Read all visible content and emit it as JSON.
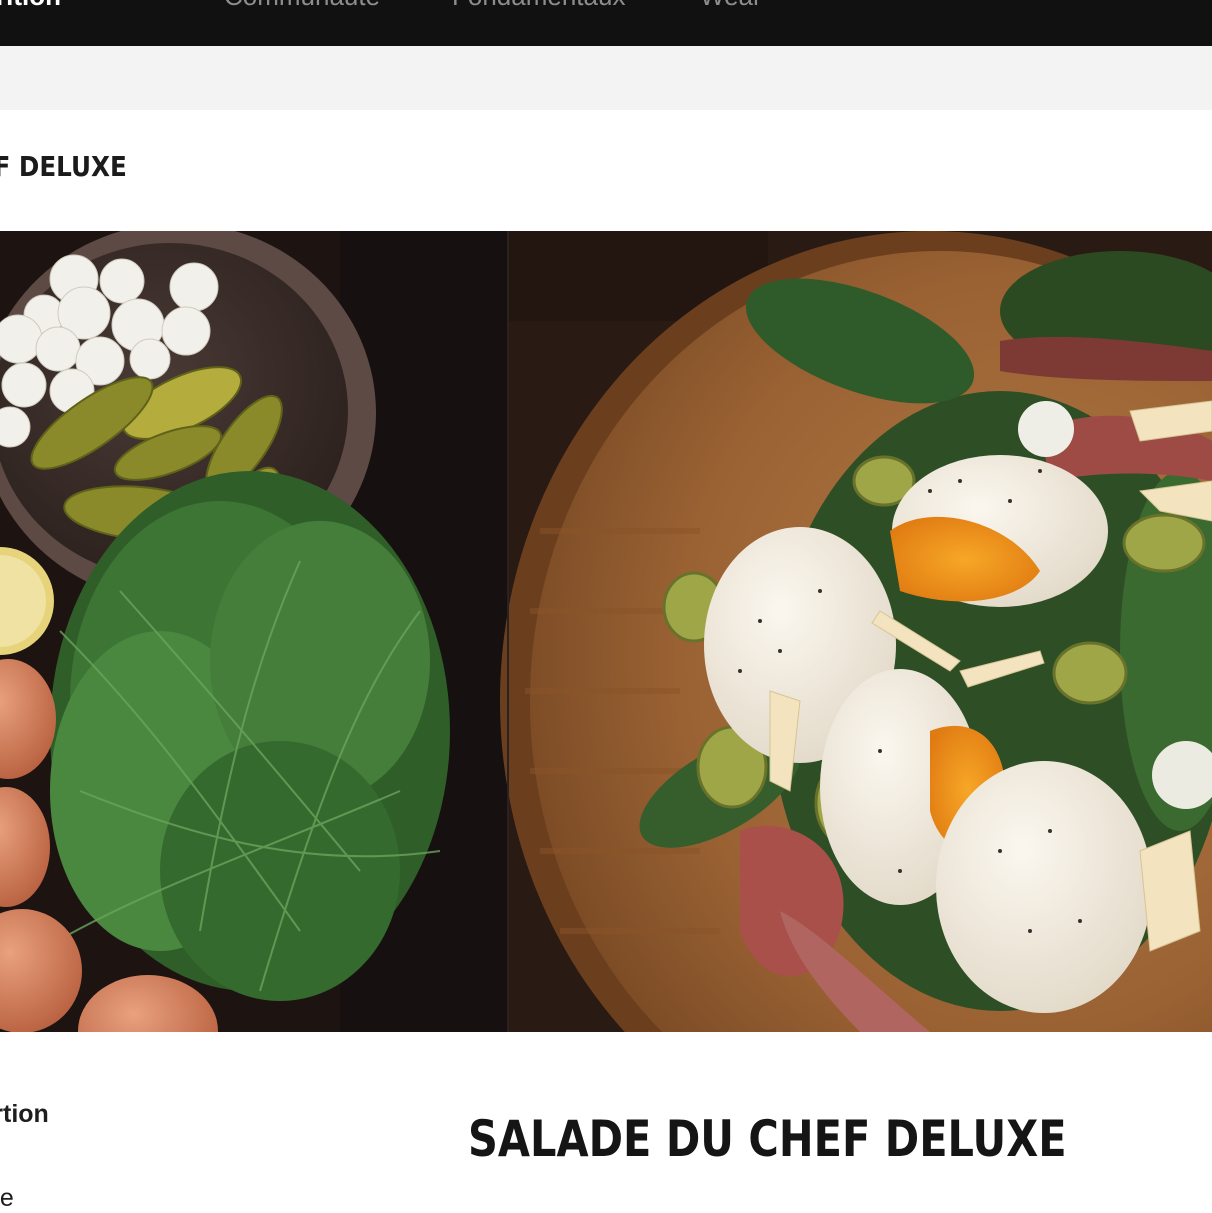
{
  "nav": {
    "brand": "rition",
    "items": [
      "Communauté",
      "Fondamentaux",
      "Wear"
    ]
  },
  "page": {
    "title": "HEF DELUXE",
    "hero_alt_left": "ingredients",
    "hero_alt_right": "salad bowl"
  },
  "info": {
    "label": "ortion",
    "value": "tte"
  },
  "recipe": {
    "title": "SALADE DU CHEF DELUXE"
  },
  "colors": {
    "nav_bg": "#111111",
    "subbar_bg": "#f3f3f3"
  }
}
